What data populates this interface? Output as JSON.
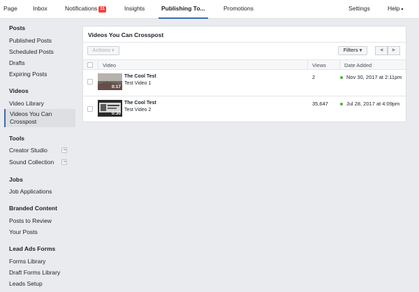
{
  "topnav": {
    "tabs": [
      {
        "label": "Page"
      },
      {
        "label": "Inbox"
      },
      {
        "label": "Notifications",
        "badge": "11"
      },
      {
        "label": "Insights"
      },
      {
        "label": "Publishing To..."
      },
      {
        "label": "Promotions"
      }
    ],
    "settings": "Settings",
    "help": "Help",
    "help_caret": "▾",
    "accent_color": "#4267b2",
    "badge_color": "#fa3e3e"
  },
  "sidebar": {
    "sections": [
      {
        "title": "Posts",
        "items": [
          "Published Posts",
          "Scheduled Posts",
          "Drafts",
          "Expiring Posts"
        ]
      },
      {
        "title": "Videos",
        "items": [
          "Video Library",
          "Videos You Can Crosspost"
        ]
      },
      {
        "title": "Tools",
        "items": [
          "Creator Studio",
          "Sound Collection"
        ]
      },
      {
        "title": "Jobs",
        "items": [
          "Job Applications"
        ]
      },
      {
        "title": "Branded Content",
        "items": [
          "Posts to Review",
          "Your Posts"
        ]
      },
      {
        "title": "Lead Ads Forms",
        "items": [
          "Forms Library",
          "Draft Forms Library",
          "Leads Setup"
        ]
      }
    ],
    "videos_crosspost_line1": "Videos You Can",
    "videos_crosspost_line2": "Crosspost",
    "external_icon": "external-link-icon"
  },
  "main": {
    "title": "Videos You Can Crosspost",
    "actions_label": "Actions",
    "filters_label": "Filters",
    "pager_prev": "◀",
    "pager_next": "▶",
    "columns": {
      "video": "Video",
      "views": "Views",
      "date_added": "Date Added"
    },
    "rows": [
      {
        "title": "The Cool Test",
        "subtitle": "Test Video 1",
        "duration": "0:17",
        "views": "2",
        "date": "Nov 30, 2017 at 2:11pm",
        "status_color": "#42b72a"
      },
      {
        "title": "The Cool Test",
        "subtitle": "Test Video 2",
        "duration": "0:30",
        "views": "35,647",
        "date": "Jul 28, 2017 at 4:09pm",
        "status_color": "#42b72a"
      }
    ]
  }
}
